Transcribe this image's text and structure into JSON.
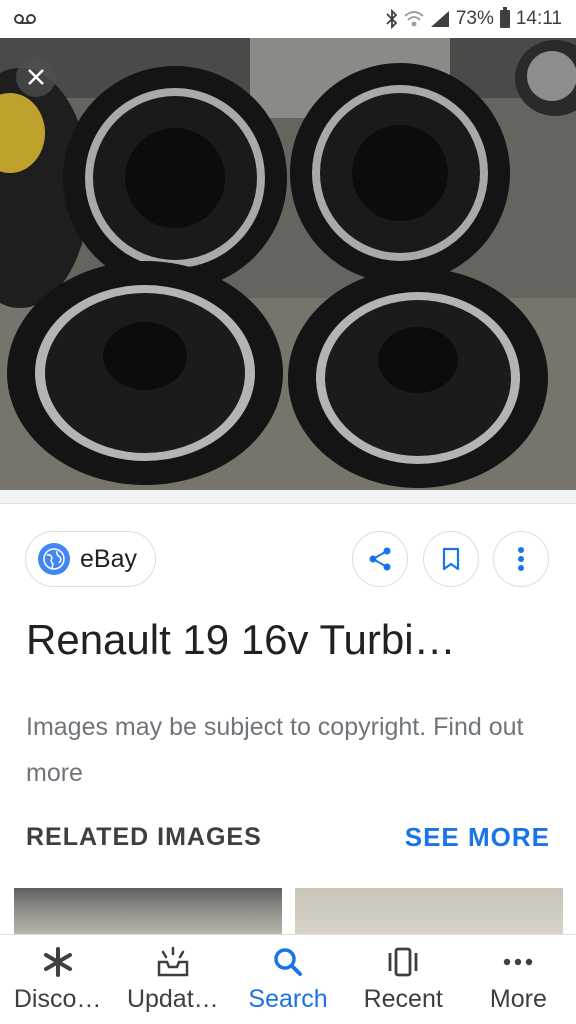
{
  "status_bar": {
    "voicemail_icon": "voicemail-icon",
    "battery_percent": "73%",
    "time": "14:11"
  },
  "image_viewer": {
    "close_icon": "close-icon"
  },
  "source": {
    "label": "eBay",
    "icon": "globe-icon"
  },
  "actions": {
    "share_icon": "share-icon",
    "bookmark_icon": "bookmark-icon",
    "more_icon": "more-vert-icon"
  },
  "title": "Renault 19 16v Turbi…",
  "copyright": {
    "text": "Images may be subject to copyright. ",
    "link": "Find out more"
  },
  "related": {
    "title": "RELATED IMAGES",
    "see_more": "SEE MORE"
  },
  "bottom_nav": {
    "items": [
      {
        "label": "Disco…",
        "icon": "asterisk-icon",
        "active": false
      },
      {
        "label": "Updat…",
        "icon": "updates-icon",
        "active": false
      },
      {
        "label": "Search",
        "icon": "search-icon",
        "active": true
      },
      {
        "label": "Recent",
        "icon": "recent-icon",
        "active": false
      },
      {
        "label": "More",
        "icon": "more-horiz-icon",
        "active": false
      }
    ]
  },
  "colors": {
    "accent": "#1a73e8",
    "text": "#202124",
    "secondary_text": "#70757a"
  }
}
